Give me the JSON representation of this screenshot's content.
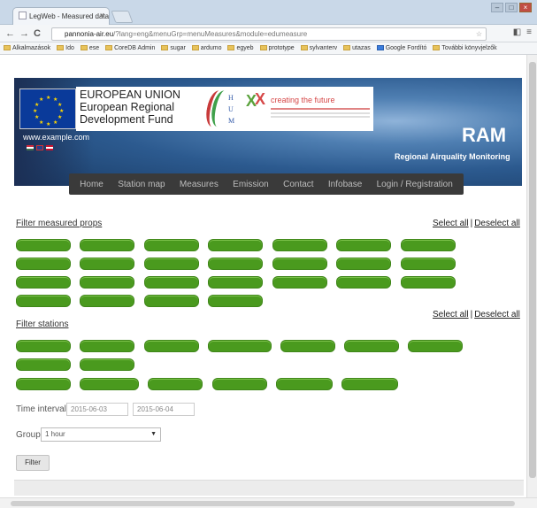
{
  "browser": {
    "tab_title": "LegWeb - Measured data",
    "tab_close": "×",
    "url_domain": "pannonia-air.eu",
    "url_path": "/?lang=eng&menuGrp=menuMeasures&module=edumeasure",
    "back": "←",
    "forward": "→",
    "reload": "C",
    "bookmarks": [
      "Alkalmazások",
      "Ido",
      "ese",
      "CoreDB Admin",
      "sugar",
      "ardumo",
      "egyeb",
      "prototype",
      "sylvanterv",
      "utazas",
      "Google Fordító",
      "További könyvjelzők"
    ]
  },
  "banner": {
    "eu_line1": "EUROPEAN UNION",
    "eu_line2": "European Regional",
    "eu_line3": "Development Fund",
    "hum_letters": [
      "H",
      "U",
      "M"
    ],
    "future_tagline": "creating the future",
    "site_url": "www.example.com",
    "ram_title": "RAM",
    "ram_subtitle": "Regional Airquality Monitoring"
  },
  "menu": [
    "Home",
    "Station map",
    "Measures",
    "Emission",
    "Contact",
    "Infobase",
    "Login / Registration"
  ],
  "filter_props": {
    "heading": "Filter measured props",
    "select_all": "Select all",
    "separator": "|",
    "deselect_all": "Deselect all",
    "pill_count": 25
  },
  "filter_stations": {
    "heading": "Filter stations",
    "select_all": "Select all",
    "separator": "|",
    "deselect_all": "Deselect all",
    "pill_count": 15
  },
  "time_interval": {
    "label": "Time interval",
    "from": "2015-06-03",
    "to": "2015-06-04"
  },
  "group": {
    "label": "Group",
    "value": "1 hour"
  },
  "filter_button": "Filter"
}
